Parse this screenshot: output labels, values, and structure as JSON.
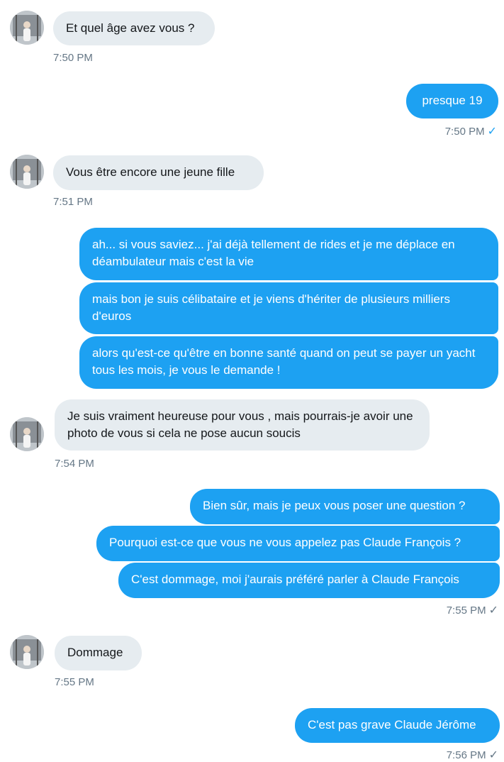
{
  "colors": {
    "sent_bubble": "#1da1f2",
    "received_bubble": "#e6ecf0",
    "timestamp": "#657786"
  },
  "messages": [
    {
      "from": "them",
      "text": "Et quel âge avez vous ?"
    },
    {
      "from": "them_time",
      "text": "7:50 PM"
    },
    {
      "from": "me",
      "text": "presque 19"
    },
    {
      "from": "me_time",
      "text": "7:50 PM",
      "status": "✓"
    },
    {
      "from": "them",
      "text": "Vous être encore une jeune fille"
    },
    {
      "from": "them_time",
      "text": "7:51 PM"
    },
    {
      "from": "me",
      "text": "ah... si vous saviez... j'ai déjà tellement de rides et je me déplace en déambulateur mais c'est la vie"
    },
    {
      "from": "me",
      "text": "mais bon je suis célibataire et je viens d'hériter de plusieurs milliers d'euros"
    },
    {
      "from": "me",
      "text": "alors qu'est-ce qu'être en bonne santé quand on peut se payer un yacht tous les mois, je vous le demande !"
    },
    {
      "from": "them",
      "text": "Je suis vraiment heureuse pour vous , mais pourrais-je avoir une photo de vous si cela ne pose aucun soucis"
    },
    {
      "from": "them_time",
      "text": "7:54 PM"
    },
    {
      "from": "me",
      "text": "Bien sûr, mais je peux vous poser une question ?"
    },
    {
      "from": "me",
      "text": "Pourquoi est-ce que vous ne vous appelez pas Claude François ?"
    },
    {
      "from": "me",
      "text": "C'est dommage, moi j'aurais préféré parler à Claude François"
    },
    {
      "from": "me_time",
      "text": "7:55 PM",
      "status": "✓"
    },
    {
      "from": "them",
      "text": "Dommage"
    },
    {
      "from": "them_time",
      "text": "7:55 PM"
    },
    {
      "from": "me",
      "text": "C'est pas grave Claude Jérôme"
    },
    {
      "from": "me_time",
      "text": "7:56 PM",
      "status": "✓"
    }
  ]
}
